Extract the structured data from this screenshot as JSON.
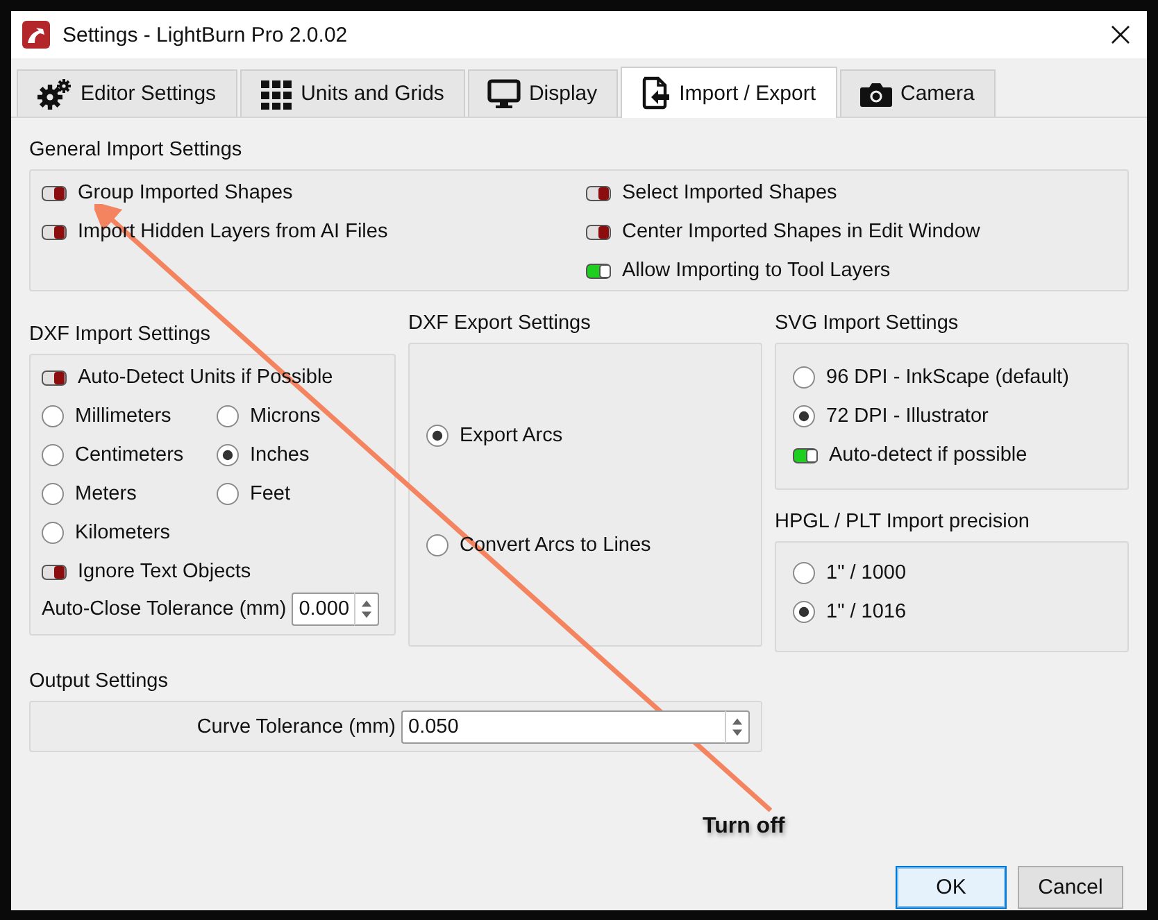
{
  "window": {
    "title": "Settings - LightBurn Pro 2.0.02"
  },
  "tabs": [
    {
      "label": "Editor Settings",
      "kind": "gear",
      "selected": false
    },
    {
      "label": "Units and Grids",
      "kind": "grid",
      "selected": false
    },
    {
      "label": "Display",
      "kind": "monitor",
      "selected": false
    },
    {
      "label": "Import / Export",
      "kind": "import",
      "selected": true
    },
    {
      "label": "Camera",
      "kind": "camera",
      "selected": false
    }
  ],
  "general_import": {
    "title": "General Import Settings",
    "left": [
      {
        "label": "Group Imported Shapes",
        "on": false
      },
      {
        "label": "Import Hidden Layers from AI Files",
        "on": false
      }
    ],
    "right": [
      {
        "label": "Select Imported Shapes",
        "on": false
      },
      {
        "label": "Center Imported Shapes in Edit Window",
        "on": false
      },
      {
        "label": "Allow Importing to Tool Layers",
        "on": true
      }
    ]
  },
  "dxf_import": {
    "title": "DXF Import Settings",
    "auto_detect": {
      "label": "Auto-Detect Units if Possible",
      "on": false
    },
    "units": [
      {
        "label": "Millimeters",
        "selected": false
      },
      {
        "label": "Microns",
        "selected": false
      },
      {
        "label": "Centimeters",
        "selected": false
      },
      {
        "label": "Inches",
        "selected": true
      },
      {
        "label": "Meters",
        "selected": false
      },
      {
        "label": "Feet",
        "selected": false
      },
      {
        "label": "Kilometers",
        "selected": false
      }
    ],
    "ignore_text": {
      "label": "Ignore Text Objects",
      "on": false
    },
    "auto_close": {
      "label": "Auto-Close Tolerance (mm)",
      "value": "0.000"
    }
  },
  "dxf_export": {
    "title": "DXF Export Settings",
    "options": [
      {
        "label": "Export Arcs",
        "selected": true
      },
      {
        "label": "Convert Arcs to Lines",
        "selected": false
      }
    ]
  },
  "svg_import": {
    "title": "SVG Import Settings",
    "options": [
      {
        "label": "96 DPI - InkScape (default)",
        "selected": false
      },
      {
        "label": "72 DPI - Illustrator",
        "selected": true
      }
    ],
    "auto_detect": {
      "label": "Auto-detect if possible",
      "on": true
    }
  },
  "hpgl_import": {
    "title": "HPGL / PLT Import precision",
    "options": [
      {
        "label": "1\" / 1000",
        "selected": false
      },
      {
        "label": "1\" / 1016",
        "selected": true
      }
    ]
  },
  "output": {
    "title": "Output Settings",
    "curve_tolerance": {
      "label": "Curve Tolerance (mm)",
      "value": "0.050"
    }
  },
  "buttons": [
    {
      "label": "OK",
      "default": true
    },
    {
      "label": "Cancel",
      "default": false
    }
  ],
  "annotation": {
    "text": "Turn off"
  }
}
